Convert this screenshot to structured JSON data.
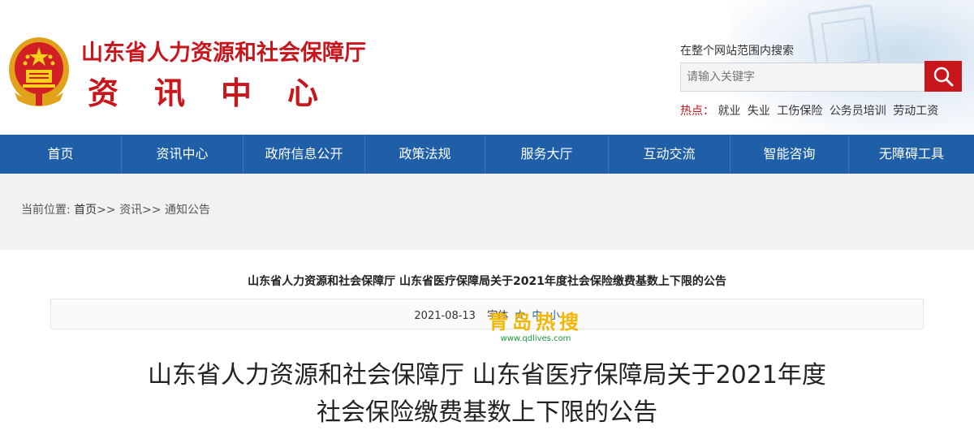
{
  "header": {
    "title_line1": "山东省人力资源和社会保障厅",
    "title_line2": "资讯中心",
    "emblem_icon": "national-emblem-icon",
    "brand_color": "#c8161d"
  },
  "search": {
    "label": "在整个网站范围内搜索",
    "placeholder": "请输入关键字",
    "button_icon": "search-icon"
  },
  "hot": {
    "label": "热点：",
    "items": [
      "就业",
      "失业",
      "工伤保险",
      "公务员培训",
      "劳动工资"
    ]
  },
  "nav": {
    "color": "#1f5fa8",
    "items": [
      {
        "label": "首页"
      },
      {
        "label": "资讯中心"
      },
      {
        "label": "政府信息公开"
      },
      {
        "label": "政策法规"
      },
      {
        "label": "服务大厅"
      },
      {
        "label": "互动交流"
      },
      {
        "label": "智能咨询"
      },
      {
        "label": "无障碍工具"
      }
    ]
  },
  "breadcrumb": {
    "prefix": "当前位置:",
    "home": "首页",
    "sep1": ">>",
    "level2": "资讯",
    "sep2": ">>",
    "level3": "通知公告"
  },
  "article": {
    "title_small": "山东省人力资源和社会保障厅 山东省医疗保障局关于2021年度社会保险缴费基数上下限的公告",
    "date": "2021-08-13",
    "font_label": "字体",
    "size_large": "大",
    "size_medium": "中",
    "size_small": "小",
    "title_big_line1": "山东省人力资源和社会保障厅 山东省医疗保障局关于2021年度",
    "title_big_line2": "社会保险缴费基数上下限的公告"
  },
  "watermark": {
    "text": "青岛热搜",
    "url": "www.qdlives.com"
  }
}
